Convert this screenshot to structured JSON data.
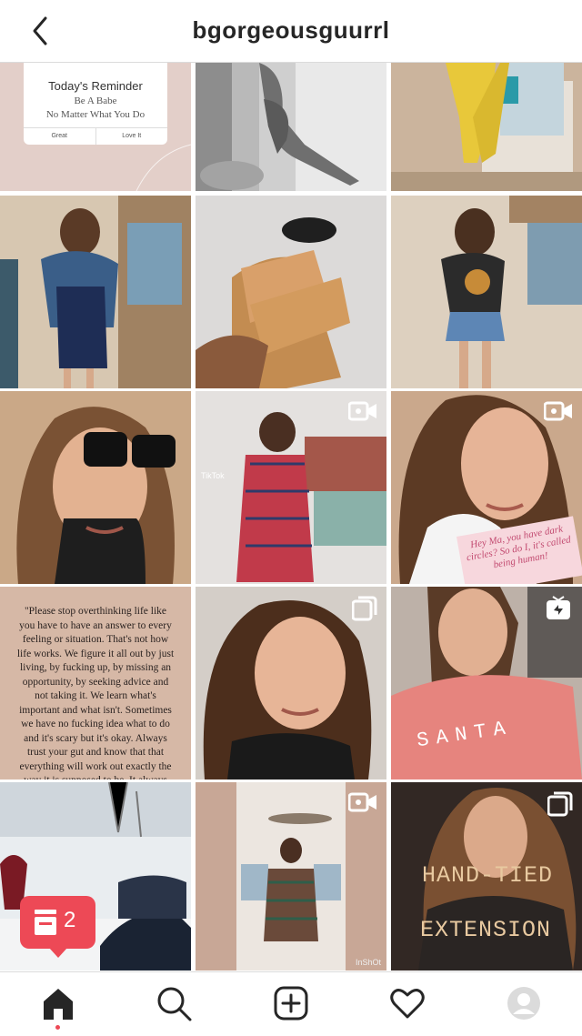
{
  "header": {
    "title": "bgorgeousguurrl",
    "back_icon": "chevron-left-icon"
  },
  "grid": {
    "reminder_card": {
      "title": "Today's Reminder",
      "line1": "Be A Babe",
      "line2": "No Matter What You Do",
      "button_left": "Great",
      "button_right": "Love It"
    },
    "quote_text": "\"Please stop overthinking life like you have to have an answer to every feeling or situation. That's not how life works. We figure it all out by just living, by fucking up, by missing an opportunity, by seeking advice and not taking it. We learn what's important and what isn't. Sometimes we have no fucking idea what to do and it's scary but it's okay. Always trust your gut and know that that everything will work out exactly the way it is supposed to be. It always does. Relax, we were never in",
    "pink_note": "Hey Ma, you have dark circles? So do I, it's called being human!",
    "tiktok_label": "TikTok",
    "inshot_label": "InShOt",
    "overlay_line1": "HAND-TIED",
    "overlay_line2": "EXTENSION",
    "shirt_text": "SANTA"
  },
  "notification_badge": {
    "count": "2",
    "icon": "comment-stack-icon",
    "color": "#ed4956"
  },
  "tabbar": {
    "items": [
      "home-icon",
      "search-icon",
      "new-post-icon",
      "activity-heart-icon",
      "profile-avatar-icon"
    ]
  }
}
